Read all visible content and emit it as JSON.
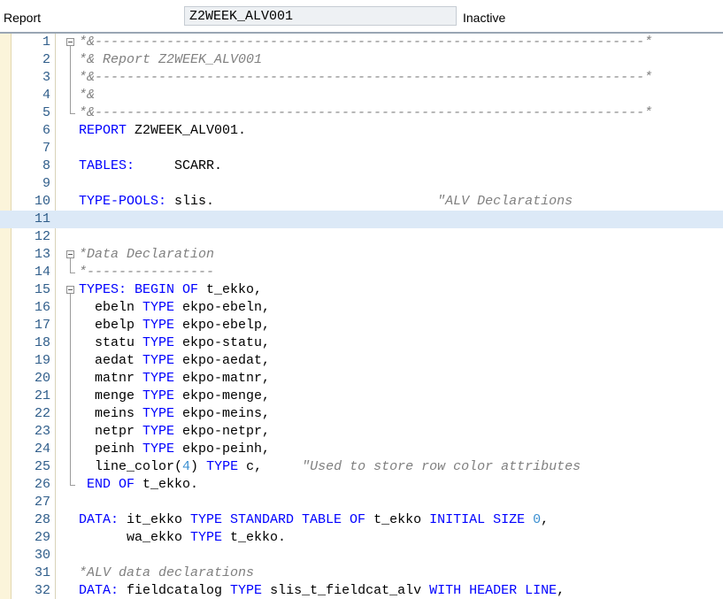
{
  "header": {
    "label": "Report",
    "program_name": "Z2WEEK_ALV001",
    "status": "Inactive"
  },
  "colors": {
    "keyword": "#0000ff",
    "comment": "#808080",
    "number": "#3a8fd1",
    "line_number": "#2f5d8a",
    "current_line": "#dce9f7",
    "margin": "#fbf4da"
  },
  "current_line": 11,
  "lines": [
    {
      "n": "1",
      "fold": "open",
      "tokens": [
        [
          "cm",
          "*&---------------------------------------------------------------------*"
        ]
      ]
    },
    {
      "n": "2",
      "tokens": [
        [
          "cm",
          "*& Report Z2WEEK_ALV001"
        ]
      ]
    },
    {
      "n": "3",
      "tokens": [
        [
          "cm",
          "*&---------------------------------------------------------------------*"
        ]
      ]
    },
    {
      "n": "4",
      "tokens": [
        [
          "cm",
          "*&"
        ]
      ]
    },
    {
      "n": "5",
      "fold": "end",
      "tokens": [
        [
          "cm",
          "*&---------------------------------------------------------------------*"
        ]
      ]
    },
    {
      "n": "6",
      "tokens": [
        [
          "kw",
          "REPORT"
        ],
        [
          "id",
          " Z2WEEK_ALV001."
        ]
      ]
    },
    {
      "n": "7",
      "tokens": []
    },
    {
      "n": "8",
      "tokens": [
        [
          "kw",
          "TABLES:"
        ],
        [
          "id",
          "     SCARR."
        ]
      ]
    },
    {
      "n": "9",
      "tokens": []
    },
    {
      "n": "10",
      "tokens": [
        [
          "kw",
          "TYPE-POOLS:"
        ],
        [
          "id",
          " slis.                            "
        ],
        [
          "cm",
          "\"ALV Declarations"
        ]
      ]
    },
    {
      "n": "11",
      "tokens": []
    },
    {
      "n": "12",
      "tokens": []
    },
    {
      "n": "13",
      "fold": "open",
      "tokens": [
        [
          "cm",
          "*Data Declaration"
        ]
      ]
    },
    {
      "n": "14",
      "fold": "end",
      "tokens": [
        [
          "cm",
          "*----------------"
        ]
      ]
    },
    {
      "n": "15",
      "fold": "open",
      "tokens": [
        [
          "kw",
          "TYPES:"
        ],
        [
          "id",
          " "
        ],
        [
          "kw",
          "BEGIN OF"
        ],
        [
          "id",
          " t_ekko,"
        ]
      ]
    },
    {
      "n": "16",
      "tokens": [
        [
          "id",
          "  ebeln "
        ],
        [
          "kw",
          "TYPE"
        ],
        [
          "id",
          " ekpo-ebeln,"
        ]
      ]
    },
    {
      "n": "17",
      "tokens": [
        [
          "id",
          "  ebelp "
        ],
        [
          "kw",
          "TYPE"
        ],
        [
          "id",
          " ekpo-ebelp,"
        ]
      ]
    },
    {
      "n": "18",
      "tokens": [
        [
          "id",
          "  statu "
        ],
        [
          "kw",
          "TYPE"
        ],
        [
          "id",
          " ekpo-statu,"
        ]
      ]
    },
    {
      "n": "19",
      "tokens": [
        [
          "id",
          "  aedat "
        ],
        [
          "kw",
          "TYPE"
        ],
        [
          "id",
          " ekpo-aedat,"
        ]
      ]
    },
    {
      "n": "20",
      "tokens": [
        [
          "id",
          "  matnr "
        ],
        [
          "kw",
          "TYPE"
        ],
        [
          "id",
          " ekpo-matnr,"
        ]
      ]
    },
    {
      "n": "21",
      "tokens": [
        [
          "id",
          "  menge "
        ],
        [
          "kw",
          "TYPE"
        ],
        [
          "id",
          " ekpo-menge,"
        ]
      ]
    },
    {
      "n": "22",
      "tokens": [
        [
          "id",
          "  meins "
        ],
        [
          "kw",
          "TYPE"
        ],
        [
          "id",
          " ekpo-meins,"
        ]
      ]
    },
    {
      "n": "23",
      "tokens": [
        [
          "id",
          "  netpr "
        ],
        [
          "kw",
          "TYPE"
        ],
        [
          "id",
          " ekpo-netpr,"
        ]
      ]
    },
    {
      "n": "24",
      "tokens": [
        [
          "id",
          "  peinh "
        ],
        [
          "kw",
          "TYPE"
        ],
        [
          "id",
          " ekpo-peinh,"
        ]
      ]
    },
    {
      "n": "25",
      "tokens": [
        [
          "id",
          "  line_color("
        ],
        [
          "nm",
          "4"
        ],
        [
          "id",
          ") "
        ],
        [
          "kw",
          "TYPE"
        ],
        [
          "id",
          " c,     "
        ],
        [
          "cm",
          "\"Used to store row color attributes"
        ]
      ]
    },
    {
      "n": "26",
      "fold": "end",
      "tokens": [
        [
          "id",
          " "
        ],
        [
          "kw",
          "END OF"
        ],
        [
          "id",
          " t_ekko."
        ]
      ]
    },
    {
      "n": "27",
      "tokens": []
    },
    {
      "n": "28",
      "tokens": [
        [
          "kw",
          "DATA:"
        ],
        [
          "id",
          " it_ekko "
        ],
        [
          "kw",
          "TYPE STANDARD TABLE OF"
        ],
        [
          "id",
          " t_ekko "
        ],
        [
          "kw",
          "INITIAL SIZE"
        ],
        [
          "id",
          " "
        ],
        [
          "nm",
          "0"
        ],
        [
          "id",
          ","
        ]
      ]
    },
    {
      "n": "29",
      "tokens": [
        [
          "id",
          "      wa_ekko "
        ],
        [
          "kw",
          "TYPE"
        ],
        [
          "id",
          " t_ekko."
        ]
      ]
    },
    {
      "n": "30",
      "tokens": []
    },
    {
      "n": "31",
      "tokens": [
        [
          "cm",
          "*ALV data declarations"
        ]
      ]
    },
    {
      "n": "32",
      "tokens": [
        [
          "kw",
          "DATA:"
        ],
        [
          "id",
          " fieldcatalog "
        ],
        [
          "kw",
          "TYPE"
        ],
        [
          "id",
          " slis_t_fieldcat_alv "
        ],
        [
          "kw",
          "WITH HEADER LINE"
        ],
        [
          "id",
          ","
        ]
      ]
    }
  ]
}
